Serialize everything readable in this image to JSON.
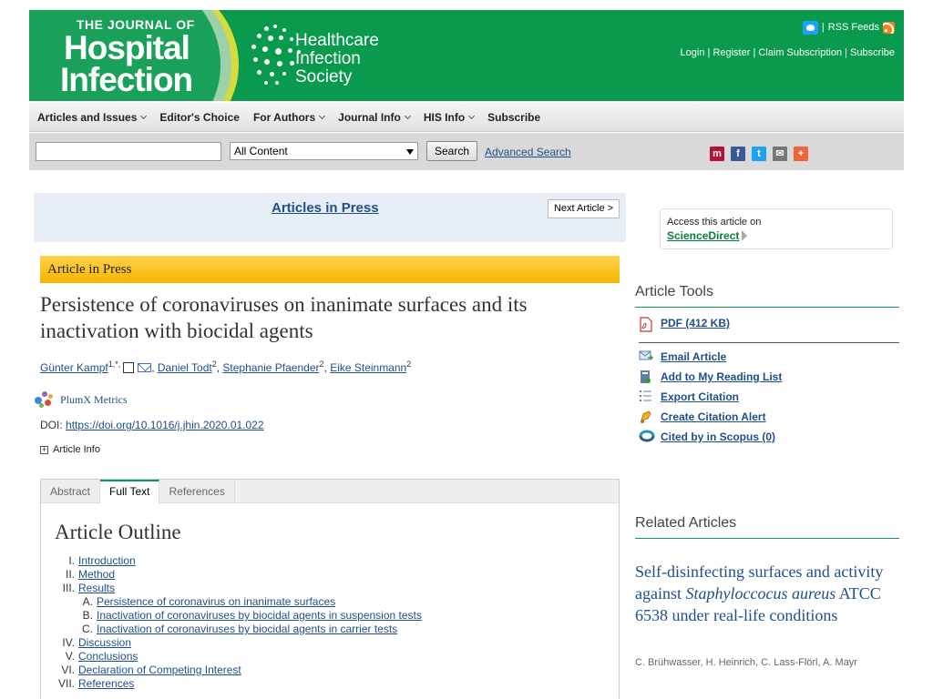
{
  "header": {
    "journal_line1": "THE JOURNAL OF",
    "journal_line2": "Hospital",
    "journal_line3": "Infection",
    "society_line1": "Healthcare",
    "society_line2": "Infection",
    "society_line3": "Society",
    "rss": "RSS Feeds",
    "links": [
      "Login",
      "Register",
      "Claim Subscription",
      "Subscribe"
    ]
  },
  "nav": [
    {
      "label": "Articles and Issues",
      "dropdown": true
    },
    {
      "label": "Editor's Choice",
      "dropdown": false
    },
    {
      "label": "For Authors",
      "dropdown": true
    },
    {
      "label": "Journal Info",
      "dropdown": true
    },
    {
      "label": "HIS Info",
      "dropdown": true
    },
    {
      "label": "Subscribe",
      "dropdown": false
    }
  ],
  "search": {
    "placeholder": "",
    "scope": "All Content",
    "button": "Search",
    "advanced": "Advanced Search"
  },
  "share": {
    "colors": [
      "#b3123a",
      "#3b5998",
      "#1da1f2",
      "#777777",
      "#f0643c"
    ],
    "icons": [
      "mendeley-icon",
      "facebook-icon",
      "twitter-icon",
      "email-icon",
      "addthis-icon"
    ]
  },
  "aip": {
    "link": "Articles in Press",
    "next": "Next Article >"
  },
  "article": {
    "banner": "Article in Press",
    "title": "Persistence of coronaviruses on inanimate surfaces and its inactivation with biocidal agents",
    "authors": [
      {
        "name": "Günter Kampf",
        "sup": "1,*,"
      },
      {
        "name": "Daniel Todt",
        "sup": "2"
      },
      {
        "name": "Stephanie Pfaender",
        "sup": "2"
      },
      {
        "name": "Eike Steinmann",
        "sup": "2"
      }
    ],
    "plumx": "PlumX Metrics",
    "doi_label": "DOI: ",
    "doi": "https://doi.org/10.1016/j.jhin.2020.01.022",
    "article_info": "Article Info"
  },
  "tabs": [
    "Abstract",
    "Full Text",
    "References"
  ],
  "active_tab": "Full Text",
  "outline": {
    "title": "Article Outline",
    "items": [
      {
        "num": "I.",
        "label": "Introduction",
        "sub": false
      },
      {
        "num": "II.",
        "label": "Method",
        "sub": false
      },
      {
        "num": "III.",
        "label": "Results",
        "sub": false
      },
      {
        "num": "A.",
        "label": "Persistence of coronavirus on inanimate surfaces",
        "sub": true
      },
      {
        "num": "B.",
        "label": "Inactivation of coronaviruses by biocidal agents in suspension tests",
        "sub": true
      },
      {
        "num": "C.",
        "label": "Inactivation of coronaviruses by biocidal agents in carrier tests",
        "sub": true
      },
      {
        "num": "IV.",
        "label": "Discussion",
        "sub": false
      },
      {
        "num": "V.",
        "label": "Conclusions",
        "sub": false
      },
      {
        "num": "VI.",
        "label": "Declaration of Competing Interest",
        "sub": false
      },
      {
        "num": "VII.",
        "label": "References",
        "sub": false
      }
    ]
  },
  "sidebar": {
    "access_text": "Access this article on",
    "sciencedirect": "ScienceDirect",
    "tools_title": "Article Tools",
    "pdf": "PDF (412 KB)",
    "tools": [
      {
        "label": "Email Article",
        "icon": "email-article-icon"
      },
      {
        "label": "Add to My Reading List",
        "icon": "reading-list-icon"
      },
      {
        "label": "Export Citation",
        "icon": "export-citation-icon"
      },
      {
        "label": "Create Citation Alert",
        "icon": "citation-alert-icon"
      },
      {
        "label": "Cited by in Scopus (0)",
        "icon": "scopus-icon"
      }
    ],
    "related_title": "Related Articles",
    "related": {
      "title_pre": "Self-disinfecting surfaces and activity against ",
      "title_italic": "Staphyloccocus aureus",
      "title_post": " ATCC 6538 under real-life conditions",
      "authors": "C. Brühwasser, H. Heinrich, C. Lass-Flörl, A. Mayr"
    }
  }
}
